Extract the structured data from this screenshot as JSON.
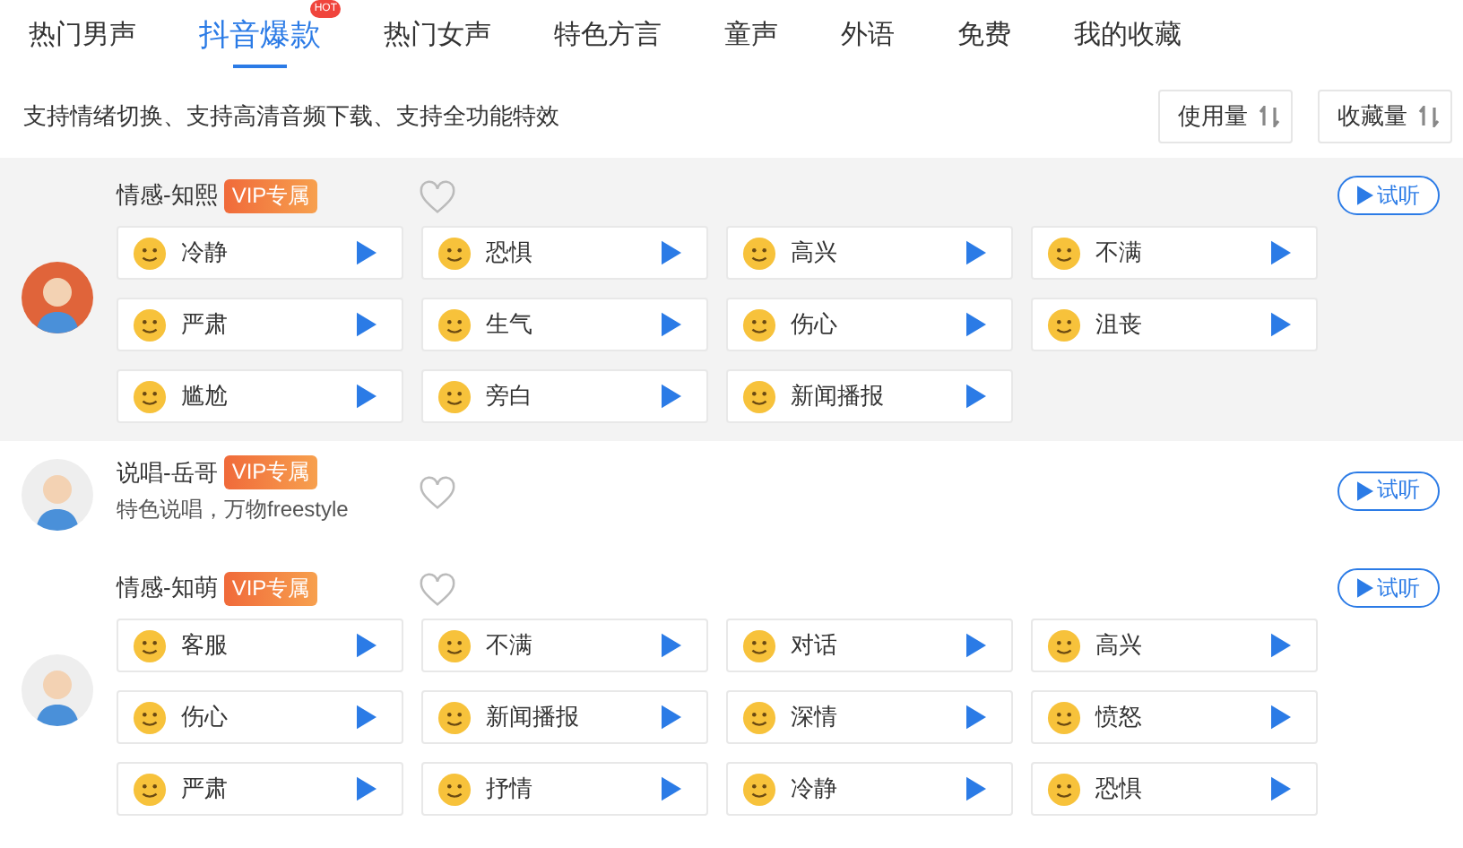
{
  "tabs": [
    {
      "label": "热门男声",
      "selected": false
    },
    {
      "label": "抖音爆款",
      "selected": true,
      "badge": "HOT"
    },
    {
      "label": "热门女声",
      "selected": false
    },
    {
      "label": "特色方言",
      "selected": false
    },
    {
      "label": "童声",
      "selected": false
    },
    {
      "label": "外语",
      "selected": false
    },
    {
      "label": "免费",
      "selected": false
    },
    {
      "label": "我的收藏",
      "selected": false
    }
  ],
  "description": "支持情绪切换、支持高清音频下载、支持全功能特效",
  "sort_buttons": [
    "使用量",
    "收藏量"
  ],
  "voices": [
    {
      "name": "情感-知熙",
      "badge": "VIP专属",
      "favorited": false,
      "selected": true,
      "color": "#e0643a",
      "trial": "试听",
      "emotions": [
        "冷静",
        "恐惧",
        "高兴",
        "不满",
        "严肃",
        "生气",
        "伤心",
        "沮丧",
        "尴尬",
        "旁白",
        "新闻播报"
      ]
    },
    {
      "name": "说唱-岳哥",
      "badge": "VIP专属",
      "favorited": false,
      "selected": false,
      "color": "#eeeeee",
      "subtitle": "特色说唱，万物freestyle",
      "trial": "试听"
    },
    {
      "name": "情感-知萌",
      "badge": "VIP专属",
      "favorited": false,
      "selected": false,
      "color": "#eeeeee",
      "trial": "试听",
      "emotions": [
        "客服",
        "不满",
        "对话",
        "高兴",
        "伤心",
        "新闻播报",
        "深情",
        "愤怒",
        "严肃",
        "抒情",
        "冷静",
        "恐惧"
      ]
    }
  ]
}
